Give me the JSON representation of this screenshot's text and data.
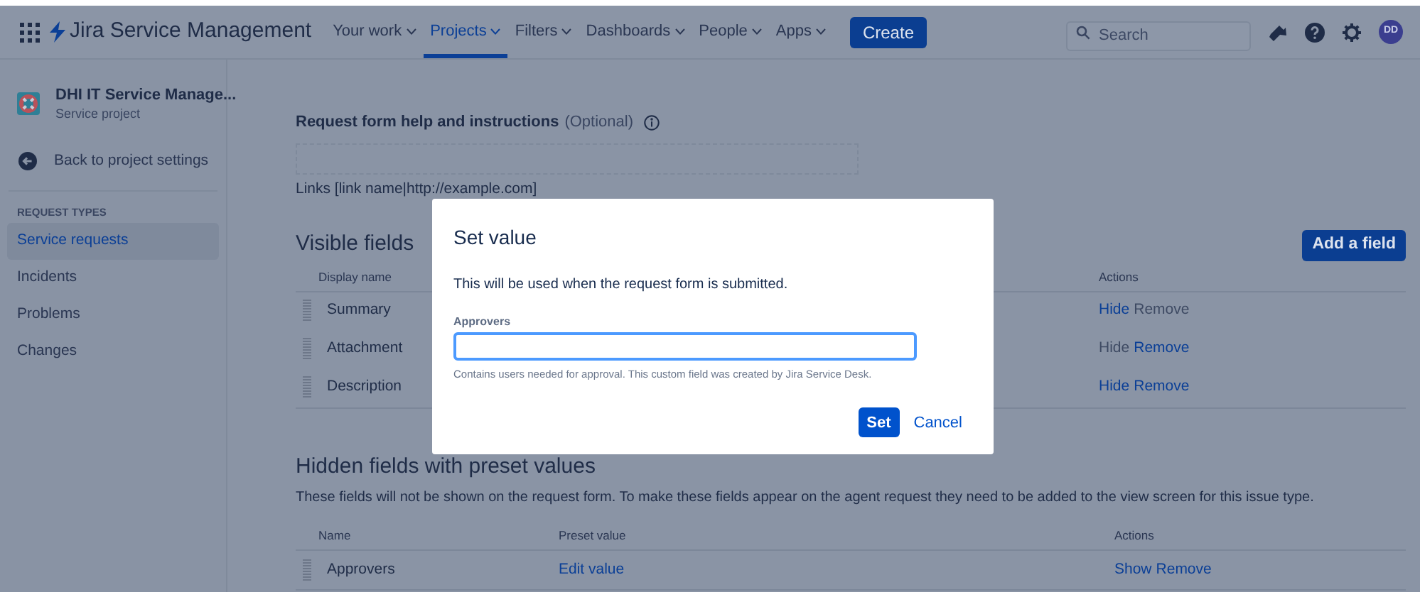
{
  "nav": {
    "product": "Jira Service Management",
    "items": [
      {
        "label": "Your work",
        "selected": false
      },
      {
        "label": "Projects",
        "selected": true
      },
      {
        "label": "Filters",
        "selected": false
      },
      {
        "label": "Dashboards",
        "selected": false
      },
      {
        "label": "People",
        "selected": false
      },
      {
        "label": "Apps",
        "selected": false
      }
    ],
    "create": "Create",
    "search": {
      "placeholder": "Search"
    },
    "avatar": "DD"
  },
  "sidebar": {
    "project": {
      "name": "DHI IT Service Manage...",
      "type": "Service project"
    },
    "back": "Back to project settings",
    "section": "REQUEST TYPES",
    "items": [
      {
        "label": "Service requests",
        "selected": true
      },
      {
        "label": "Incidents",
        "selected": false
      },
      {
        "label": "Problems",
        "selected": false
      },
      {
        "label": "Changes",
        "selected": false
      }
    ]
  },
  "help": {
    "label": "Request form help and instructions",
    "optional": "(Optional)",
    "links_hint": "Links [link name|http://example.com]"
  },
  "visible_fields": {
    "title": "Visible fields",
    "add_button": "Add a field",
    "columns": [
      "Display name",
      "Actions"
    ],
    "rows": [
      {
        "name": "Summary",
        "actions": [
          {
            "label": "Hide",
            "disabled": false
          },
          {
            "label": "Remove",
            "disabled": true
          }
        ]
      },
      {
        "name": "Attachment",
        "actions": [
          {
            "label": "Hide",
            "disabled": true
          },
          {
            "label": "Remove",
            "disabled": false
          }
        ]
      },
      {
        "name": "Description",
        "actions": [
          {
            "label": "Hide",
            "disabled": false
          },
          {
            "label": "Remove",
            "disabled": false
          }
        ]
      }
    ]
  },
  "hidden_fields": {
    "title": "Hidden fields with preset values",
    "description": "These fields will not be shown on the request form. To make these fields appear on the agent request they need to be added to the view screen for this issue type.",
    "columns": [
      "Name",
      "Preset value",
      "Actions"
    ],
    "rows": [
      {
        "name": "Approvers",
        "preset": "Edit value",
        "actions": [
          {
            "label": "Show",
            "disabled": false
          },
          {
            "label": "Remove",
            "disabled": false
          }
        ]
      }
    ]
  },
  "dialog": {
    "title": "Set value",
    "text": "This will be used when the request form is submitted.",
    "field_label": "Approvers",
    "hint": "Contains users needed for approval. This custom field was created by Jira Service Desk.",
    "buttons": [
      "Set",
      "Cancel"
    ]
  }
}
